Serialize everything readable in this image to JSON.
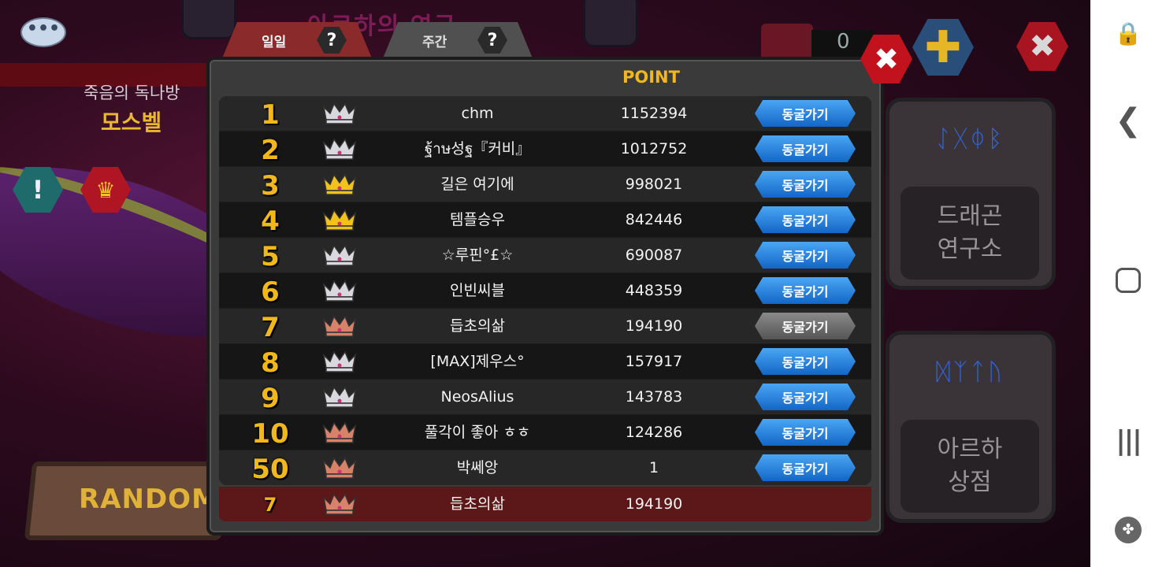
{
  "game": {
    "title": "아르하의 연구",
    "chat_icon": "•••",
    "dungeon_label": "죽음의 독나방",
    "dungeon_name": "모스벨",
    "alert_icon": "!",
    "crown_icon": "♛",
    "random_label": "RANDOM",
    "top_counter": "0",
    "plus_icon": "✚",
    "close_icon": "✖",
    "panels": {
      "lab": {
        "runes": "ᛇᚷᛰᛒ",
        "label": "드래곤\n연구소"
      },
      "shop": {
        "runes": "ᛞᛉᛏᚢ",
        "label": "아르하\n상점"
      }
    }
  },
  "popup": {
    "tabs": [
      {
        "label": "일일",
        "help": "?"
      },
      {
        "label": "주간",
        "help": "?"
      }
    ],
    "close_icon": "✖",
    "point_header": "POINT",
    "visit_label": "동굴가기"
  },
  "rankings": [
    {
      "rank": "1",
      "crown": "silver",
      "name": "chm",
      "score": "1152394",
      "visit": "active"
    },
    {
      "rank": "2",
      "crown": "silver",
      "name": "ฐ้าษ성ฐ『커비』",
      "score": "1012752",
      "visit": "active"
    },
    {
      "rank": "3",
      "crown": "gold",
      "name": "길은 여기에",
      "score": "998021",
      "visit": "active"
    },
    {
      "rank": "4",
      "crown": "gold",
      "name": "템플승우",
      "score": "842446",
      "visit": "active"
    },
    {
      "rank": "5",
      "crown": "silver",
      "name": "☆루핀°£☆",
      "score": "690087",
      "visit": "active"
    },
    {
      "rank": "6",
      "crown": "silver",
      "name": "인빈씨블",
      "score": "448359",
      "visit": "active"
    },
    {
      "rank": "7",
      "crown": "bronze",
      "name": "듭초의삶",
      "score": "194190",
      "visit": "disabled"
    },
    {
      "rank": "8",
      "crown": "silver",
      "name": "[MAX]제우스°",
      "score": "157917",
      "visit": "active"
    },
    {
      "rank": "9",
      "crown": "silver",
      "name": "NeosAlius",
      "score": "143783",
      "visit": "active"
    },
    {
      "rank": "10",
      "crown": "bronze",
      "name": "풀각이 좋아 ㅎㅎ",
      "score": "124286",
      "visit": "active"
    },
    {
      "rank": "50",
      "crown": "bronze",
      "name": "박쎄앙",
      "score": "1",
      "visit": "active"
    }
  ],
  "my_rank": {
    "rank": "7",
    "crown": "bronze",
    "name": "듭초의삶",
    "score": "194190"
  },
  "crown_colors": {
    "gold": "#f2c21c",
    "silver": "#d8d8de",
    "bronze": "#d9826a"
  },
  "nav": {
    "lock_icon": "🔒",
    "back_icon": "❮",
    "recent_icon": "|||",
    "game_icon": "✤"
  }
}
